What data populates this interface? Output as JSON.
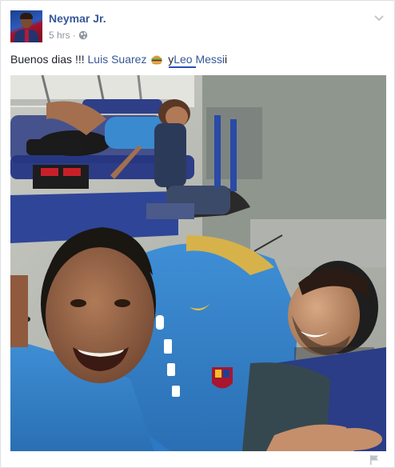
{
  "post": {
    "author": "Neymar Jr.",
    "time": "5 hrs",
    "privacy_icon": "globe-icon",
    "text_prefix": "Buenos dias !!! ",
    "tag_1": "Luis Suarez",
    "emoji": "burger-emoji",
    "text_between": " y",
    "tag_2": "Leo Messi",
    "text_suffix": "i"
  },
  "colors": {
    "link": "#365899",
    "meta": "#90949c",
    "text": "#1d2129"
  }
}
